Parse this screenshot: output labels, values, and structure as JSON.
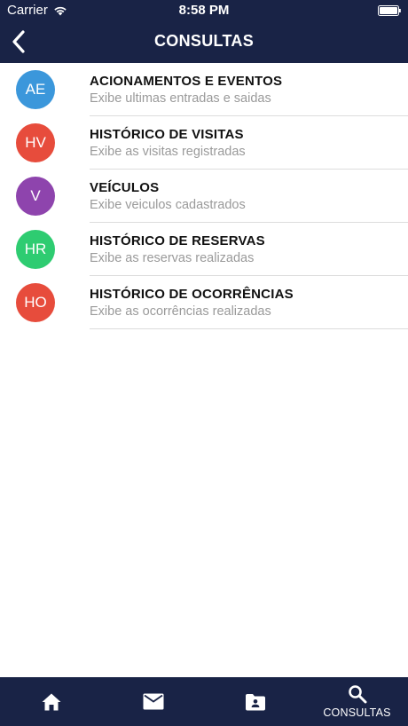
{
  "status_bar": {
    "carrier": "Carrier",
    "time": "8:58 PM",
    "wifi_icon": "wifi-icon",
    "battery_icon": "battery-icon"
  },
  "nav": {
    "title": "CONSULTAS",
    "back_icon": "chevron-left-icon"
  },
  "colors": {
    "navbar_bg": "#192346",
    "avatar_blue": "#3b97db",
    "avatar_red": "#e74c3c",
    "avatar_purple": "#8e44ad",
    "avatar_green": "#2ecc71"
  },
  "items": [
    {
      "initials": "AE",
      "title": "ACIONAMENTOS E EVENTOS",
      "subtitle": "Exibe ultimas entradas e saidas",
      "color": "#3b97db"
    },
    {
      "initials": "HV",
      "title": "HISTÓRICO DE VISITAS",
      "subtitle": "Exibe as visitas registradas",
      "color": "#e74c3c"
    },
    {
      "initials": "V",
      "title": "VEÍCULOS",
      "subtitle": "Exibe veiculos cadastrados",
      "color": "#8e44ad"
    },
    {
      "initials": "HR",
      "title": "HISTÓRICO DE RESERVAS",
      "subtitle": "Exibe as reservas realizadas",
      "color": "#2ecc71"
    },
    {
      "initials": "HO",
      "title": "HISTÓRICO DE OCORRÊNCIAS",
      "subtitle": "Exibe as ocorrências realizadas",
      "color": "#e74c3c"
    }
  ],
  "tabbar": {
    "tabs": [
      {
        "icon": "home-icon",
        "label": ""
      },
      {
        "icon": "mail-icon",
        "label": ""
      },
      {
        "icon": "folder-account-icon",
        "label": ""
      },
      {
        "icon": "search-icon",
        "label": "CONSULTAS"
      }
    ]
  }
}
